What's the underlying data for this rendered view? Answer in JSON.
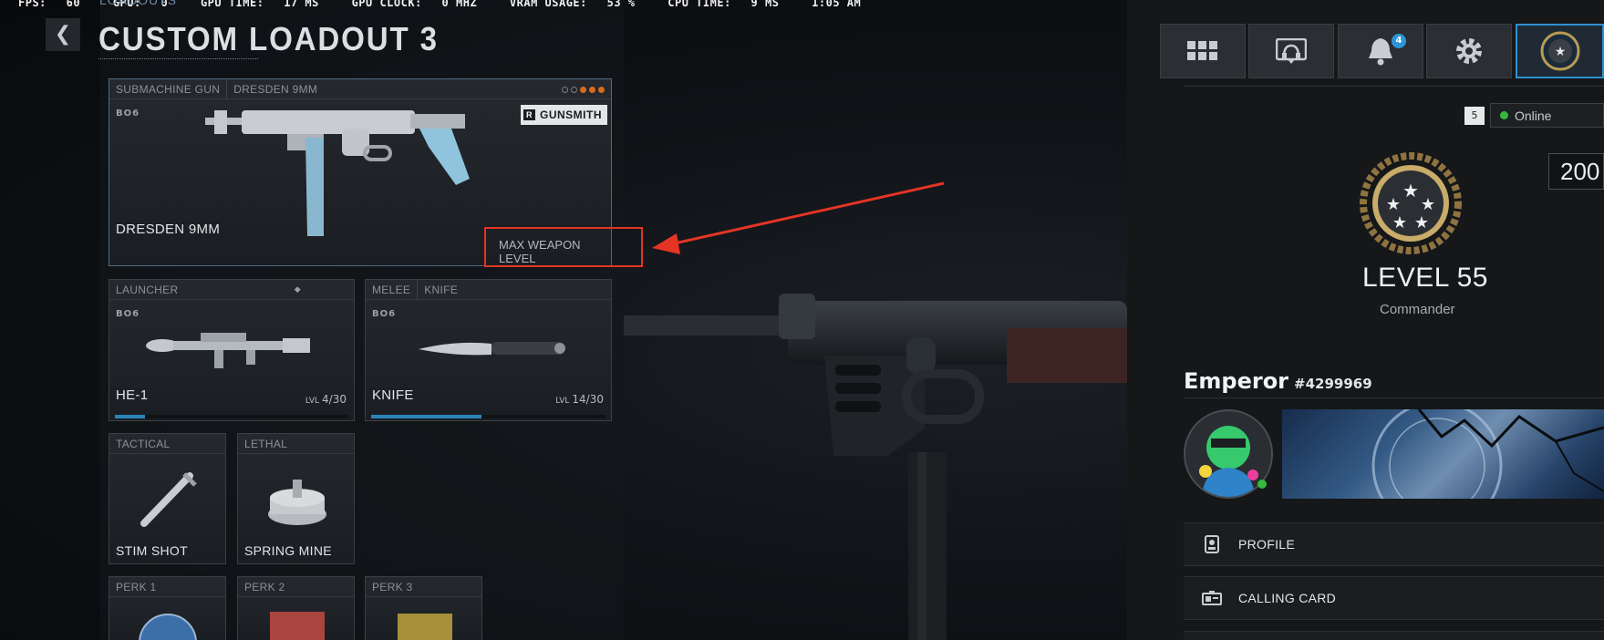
{
  "perf": {
    "fps_label": "FPS:",
    "fps": "60",
    "gpu_label": "GPU:",
    "gpu": "0",
    "gpu_time_label": "GPU TIME:",
    "gpu_time": "17 MS",
    "gpu_clock_label": "GPU CLOCK:",
    "gpu_clock": "0 MHZ",
    "vram_label": "VRAM USAGE:",
    "vram": "53 %",
    "cpu_time_label": "CPU TIME:",
    "cpu_time": "9 MS",
    "clock": "1:05 AM"
  },
  "header": {
    "breadcrumb": "LOADOUTS",
    "title": "CUSTOM LOADOUT 3",
    "back_glyph": "❮"
  },
  "primary": {
    "category": "SUBMACHINE GUN",
    "weapon_type": "DRESDEN 9MM",
    "game_tag": "BO6",
    "name": "DRESDEN 9MM",
    "gunsmith_key": "R",
    "gunsmith_label": "GUNSMITH",
    "max_level_text": "MAX WEAPON LEVEL",
    "prestige_dots": 5,
    "prestige_filled": 3
  },
  "launcher": {
    "category": "LAUNCHER",
    "game_tag": "BO6",
    "name": "HE-1",
    "lvl_prefix": "LVL",
    "lvl": "4/30",
    "progress": 0.13
  },
  "melee": {
    "category": "MELEE",
    "weapon_type": "KNIFE",
    "game_tag": "BO6",
    "name": "KNIFE",
    "lvl_prefix": "LVL",
    "lvl": "14/30",
    "progress": 0.47
  },
  "tactical": {
    "category": "TACTICAL",
    "name": "STIM SHOT"
  },
  "lethal": {
    "category": "LETHAL",
    "name": "SPRING MINE"
  },
  "perks": [
    {
      "label": "PERK 1"
    },
    {
      "label": "PERK 2"
    },
    {
      "label": "PERK 3"
    }
  ],
  "right_panel": {
    "notifications_count": "4",
    "party_count": "5",
    "status": "Online",
    "points": "200",
    "level": "LEVEL 55",
    "rank": "Commander",
    "player_name": "Emperor",
    "player_tag": "#4299969",
    "menu": [
      {
        "label": "PROFILE",
        "icon": "id-badge-icon"
      },
      {
        "label": "CALLING CARD",
        "icon": "card-icon"
      }
    ],
    "accent_color": "#2f8fd0"
  },
  "annotation": {
    "color": "#e53424"
  }
}
